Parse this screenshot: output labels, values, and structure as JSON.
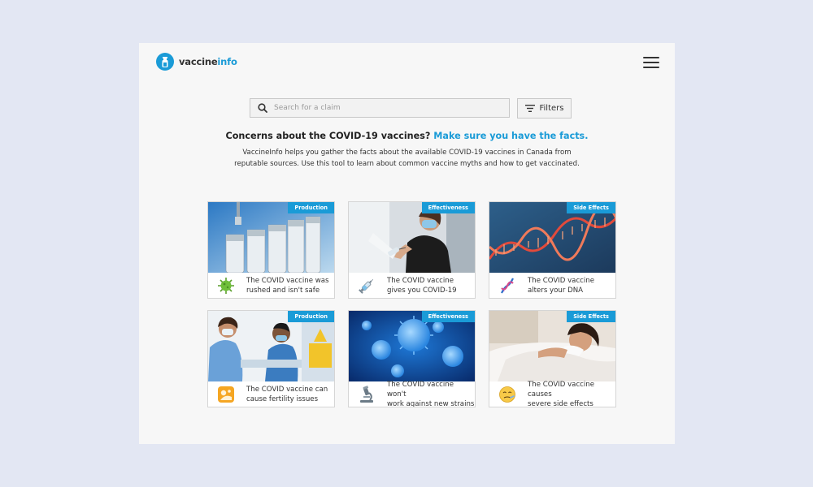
{
  "brand": {
    "name_part1": "vaccine",
    "name_part2": "info",
    "accent_color": "#1a9bd7"
  },
  "search": {
    "placeholder": "Search for a claim",
    "filters_label": "Filters"
  },
  "headline": {
    "question": "Concerns about the COVID-19 vaccines?",
    "cta": "Make sure you have the facts."
  },
  "intro": "VaccineInfo helps you gather the facts about the available COVID-19 vaccines in Canada from reputable sources. Use this tool to learn about common vaccine myths and how to get vaccinated.",
  "cards": [
    {
      "tag": "Production",
      "line1": "The COVID vaccine was",
      "line2": "rushed and isn't safe",
      "icon": "virus-icon",
      "image": "vaccine-vials-photo"
    },
    {
      "tag": "Effectiveness",
      "line1": "The COVID vaccine",
      "line2": "gives you COVID-19",
      "icon": "syringe-icon",
      "image": "woman-getting-vaccinated-photo"
    },
    {
      "tag": "Side Effects",
      "line1": "The COVID vaccine",
      "line2": "alters your DNA",
      "icon": "dna-icon",
      "image": "dna-strand-photo"
    },
    {
      "tag": "Production",
      "line1": "The COVID vaccine can",
      "line2": "cause fertility issues",
      "icon": "fertility-icon",
      "image": "pregnant-woman-with-nurse-photo"
    },
    {
      "tag": "Effectiveness",
      "line1": "The COVID vaccine won't",
      "line2": "work against new strains",
      "icon": "microscope-icon",
      "image": "virus-particles-photo"
    },
    {
      "tag": "Side Effects",
      "line1": "The COVID vaccine causes",
      "line2": "severe side effects",
      "icon": "sick-face-icon",
      "image": "sick-woman-in-bed-photo"
    }
  ]
}
